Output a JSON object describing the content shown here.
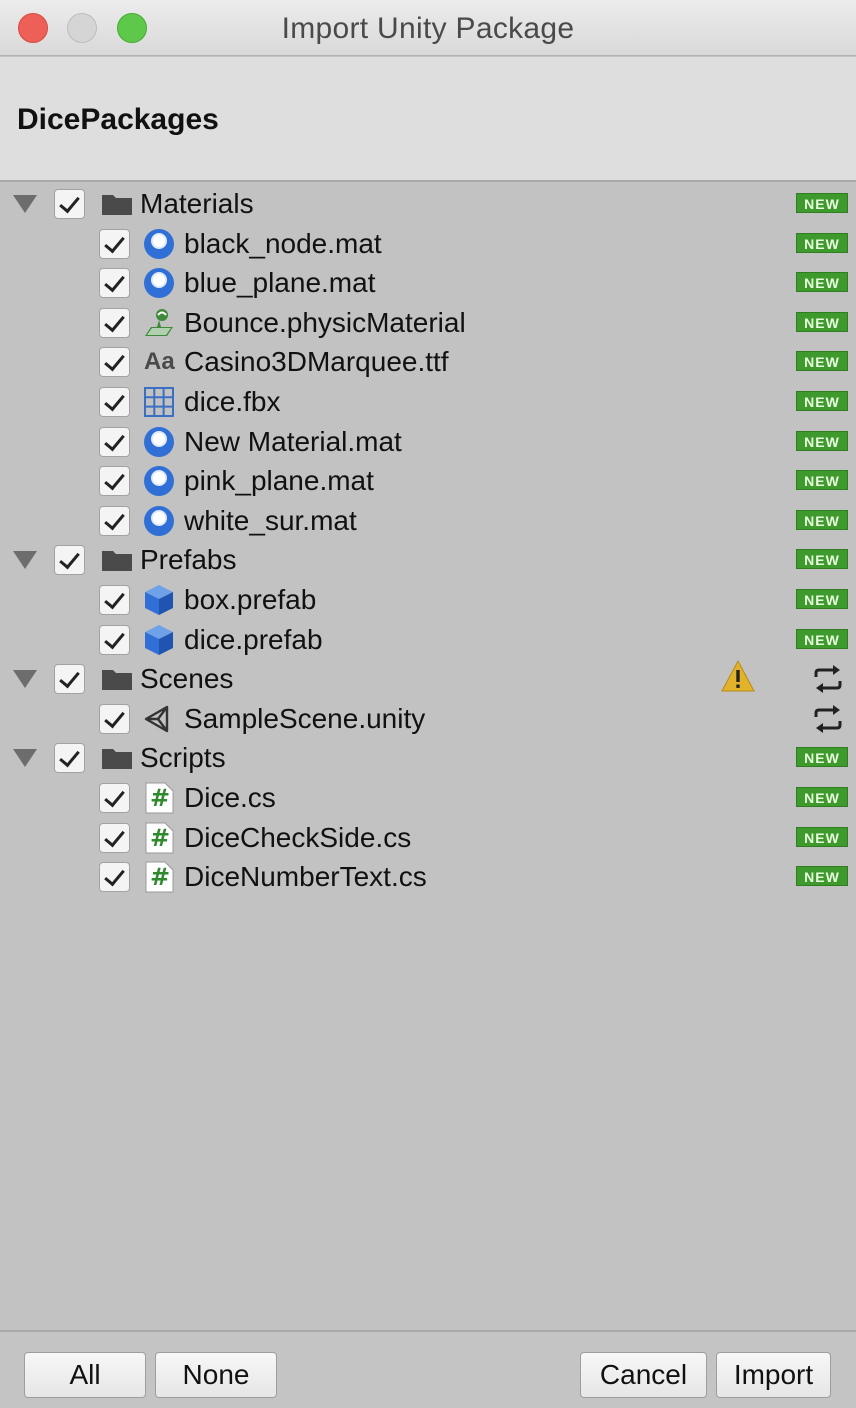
{
  "window": {
    "title": "Import Unity Package"
  },
  "header": {
    "package_name": "DicePackages"
  },
  "tree": [
    {
      "kind": "folder",
      "label": "Materials",
      "status": "new"
    },
    {
      "kind": "file",
      "icon": "material-sphere-icon",
      "label": "black_node.mat",
      "status": "new"
    },
    {
      "kind": "file",
      "icon": "material-sphere-icon",
      "label": "blue_plane.mat",
      "status": "new"
    },
    {
      "kind": "file",
      "icon": "physic-material-icon",
      "label": "Bounce.physicMaterial",
      "status": "new"
    },
    {
      "kind": "file",
      "icon": "font-icon",
      "label": "Casino3DMarquee.ttf",
      "status": "new"
    },
    {
      "kind": "file",
      "icon": "mesh-grid-icon",
      "label": "dice.fbx",
      "status": "new"
    },
    {
      "kind": "file",
      "icon": "material-sphere-icon",
      "label": "New Material.mat",
      "status": "new"
    },
    {
      "kind": "file",
      "icon": "material-sphere-icon",
      "label": "pink_plane.mat",
      "status": "new"
    },
    {
      "kind": "file",
      "icon": "material-sphere-icon",
      "label": "white_sur.mat",
      "status": "new"
    },
    {
      "kind": "folder",
      "label": "Prefabs",
      "status": "new"
    },
    {
      "kind": "file",
      "icon": "prefab-cube-icon",
      "label": "box.prefab",
      "status": "new"
    },
    {
      "kind": "file",
      "icon": "prefab-cube-icon",
      "label": "dice.prefab",
      "status": "new"
    },
    {
      "kind": "folder",
      "label": "Scenes",
      "status": "changed",
      "warning": true
    },
    {
      "kind": "file",
      "icon": "unity-scene-icon",
      "label": "SampleScene.unity",
      "status": "changed"
    },
    {
      "kind": "folder",
      "label": "Scripts",
      "status": "new"
    },
    {
      "kind": "file",
      "icon": "csharp-script-icon",
      "label": "Dice.cs",
      "status": "new"
    },
    {
      "kind": "file",
      "icon": "csharp-script-icon",
      "label": "DiceCheckSide.cs",
      "status": "new"
    },
    {
      "kind": "file",
      "icon": "csharp-script-icon",
      "label": "DiceNumberText.cs",
      "status": "new"
    }
  ],
  "badges": {
    "new_label": "NEW"
  },
  "font_icon_text": "Aa",
  "script_icon_text": "#",
  "footer": {
    "all_label": "All",
    "none_label": "None",
    "cancel_label": "Cancel",
    "import_label": "Import"
  },
  "colors": {
    "new_badge": "#3e9a2c",
    "material_blue": "#2f6fd6",
    "warning_yellow": "#e2b22a",
    "script_green": "#2f8a2f"
  }
}
